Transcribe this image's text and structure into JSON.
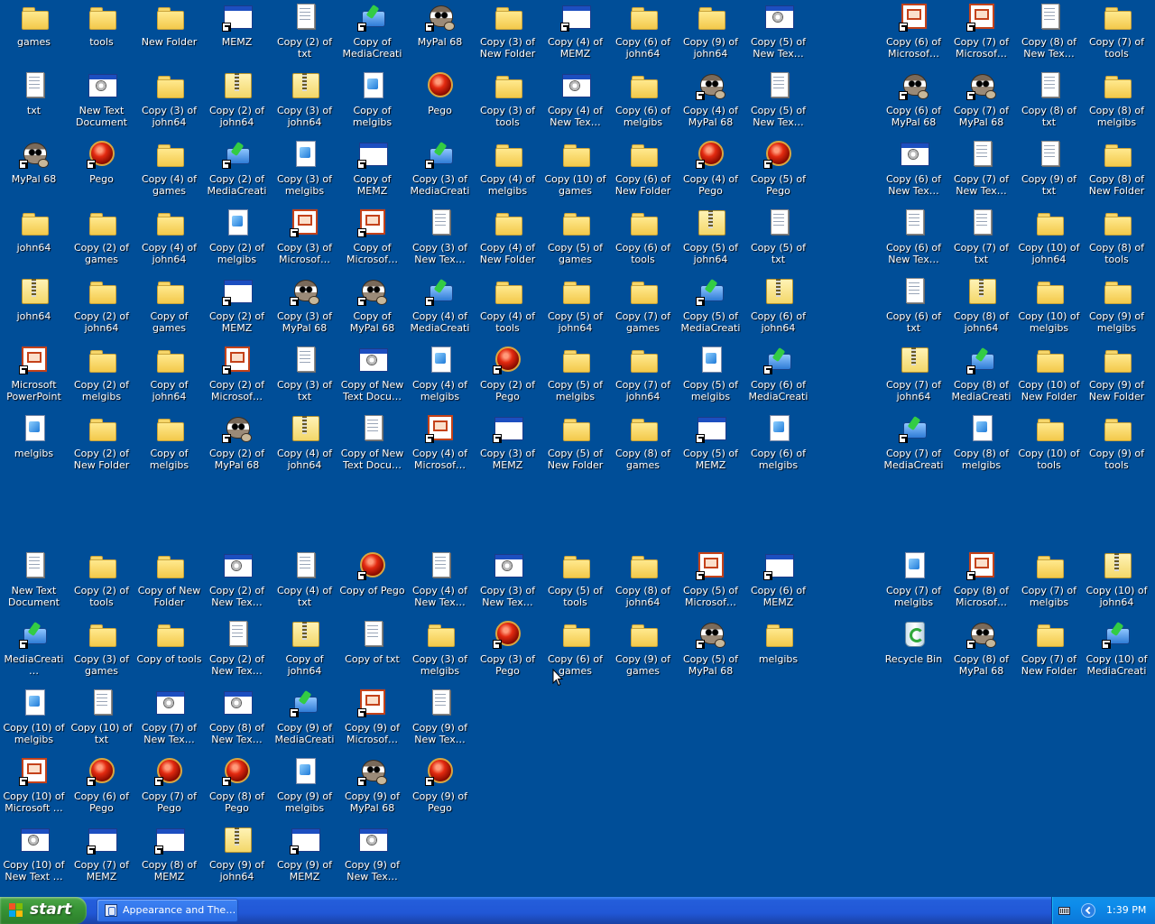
{
  "desktop": {
    "icons": [
      {
        "label": "games",
        "type": "folder",
        "shortcut": false
      },
      {
        "label": "tools",
        "type": "folder",
        "shortcut": false
      },
      {
        "label": "New Folder",
        "type": "folder",
        "shortcut": false
      },
      {
        "label": "MEMZ",
        "type": "app",
        "shortcut": true
      },
      {
        "label": "Copy (2) of txt",
        "type": "txt",
        "shortcut": false
      },
      {
        "label": "Copy of MediaCreati…",
        "type": "media",
        "shortcut": true
      },
      {
        "label": "MyPal 68",
        "type": "raccoon",
        "shortcut": true
      },
      {
        "label": "Copy (3) of New Folder",
        "type": "folder",
        "shortcut": false
      },
      {
        "label": "Copy (4) of MEMZ",
        "type": "app",
        "shortcut": true
      },
      {
        "label": "Copy (6) of john64",
        "type": "folder",
        "shortcut": false
      },
      {
        "label": "Copy (9) of john64",
        "type": "folder",
        "shortcut": false
      },
      {
        "label": "Copy (5) of New Tex…",
        "type": "window",
        "shortcut": false
      },
      {
        "label": "Copy (6) of Microsof…",
        "type": "ppt",
        "shortcut": true
      },
      {
        "label": "Copy (7) of Microsof…",
        "type": "ppt",
        "shortcut": true
      },
      {
        "label": "Copy (8) of New Tex…",
        "type": "txt",
        "shortcut": false
      },
      {
        "label": "Copy (7) of tools",
        "type": "folder",
        "shortcut": false
      },
      {
        "label": "txt",
        "type": "txt",
        "shortcut": false
      },
      {
        "label": "New Text Document",
        "type": "window",
        "shortcut": false
      },
      {
        "label": "Copy (3) of john64",
        "type": "folder",
        "shortcut": false
      },
      {
        "label": "Copy (2) of john64",
        "type": "zip",
        "shortcut": false
      },
      {
        "label": "Copy (3) of john64",
        "type": "zip",
        "shortcut": false
      },
      {
        "label": "Copy of melgibs",
        "type": "doc",
        "shortcut": false
      },
      {
        "label": "Pego",
        "type": "red",
        "shortcut": false
      },
      {
        "label": "Copy (3) of tools",
        "type": "folder",
        "shortcut": false
      },
      {
        "label": "Copy (4) of New Tex…",
        "type": "window",
        "shortcut": false
      },
      {
        "label": "Copy (6) of melgibs",
        "type": "folder",
        "shortcut": false
      },
      {
        "label": "Copy (4) of MyPal 68",
        "type": "raccoon",
        "shortcut": true
      },
      {
        "label": "Copy (5) of New Tex…",
        "type": "txt",
        "shortcut": false
      },
      {
        "label": "Copy (6) of MyPal 68",
        "type": "raccoon",
        "shortcut": true
      },
      {
        "label": "Copy (7) of MyPal 68",
        "type": "raccoon",
        "shortcut": true
      },
      {
        "label": "Copy (8) of txt",
        "type": "txt",
        "shortcut": false
      },
      {
        "label": "Copy (8) of melgibs",
        "type": "folder",
        "shortcut": false
      },
      {
        "label": "MyPal 68",
        "type": "raccoon",
        "shortcut": true
      },
      {
        "label": "Pego",
        "type": "red",
        "shortcut": true
      },
      {
        "label": "Copy (4) of games",
        "type": "folder",
        "shortcut": false
      },
      {
        "label": "Copy (2) of MediaCreati…",
        "type": "media",
        "shortcut": true
      },
      {
        "label": "Copy (3) of melgibs",
        "type": "doc",
        "shortcut": false
      },
      {
        "label": "Copy of MEMZ",
        "type": "app",
        "shortcut": true
      },
      {
        "label": "Copy (3) of MediaCreati…",
        "type": "media",
        "shortcut": true
      },
      {
        "label": "Copy (4) of melgibs",
        "type": "folder",
        "shortcut": false
      },
      {
        "label": "Copy (10) of games",
        "type": "folder",
        "shortcut": false
      },
      {
        "label": "Copy (6) of New Folder",
        "type": "folder",
        "shortcut": false
      },
      {
        "label": "Copy (4) of Pego",
        "type": "red",
        "shortcut": true
      },
      {
        "label": "Copy (5) of Pego",
        "type": "red",
        "shortcut": true
      },
      {
        "label": "Copy (6) of New Tex…",
        "type": "window",
        "shortcut": false
      },
      {
        "label": "Copy (7) of New Tex…",
        "type": "txt",
        "shortcut": false
      },
      {
        "label": "Copy (9) of txt",
        "type": "txt",
        "shortcut": false
      },
      {
        "label": "Copy (8) of New Folder",
        "type": "folder",
        "shortcut": false
      },
      {
        "label": "john64",
        "type": "folder",
        "shortcut": false
      },
      {
        "label": "Copy (2) of games",
        "type": "folder",
        "shortcut": false
      },
      {
        "label": "Copy (4) of john64",
        "type": "folder",
        "shortcut": false
      },
      {
        "label": "Copy (2) of melgibs",
        "type": "doc",
        "shortcut": false
      },
      {
        "label": "Copy (3) of Microsof…",
        "type": "ppt",
        "shortcut": true
      },
      {
        "label": "Copy of Microsof…",
        "type": "ppt",
        "shortcut": true
      },
      {
        "label": "Copy (3) of New Tex…",
        "type": "txt",
        "shortcut": false
      },
      {
        "label": "Copy (4) of New Folder",
        "type": "folder",
        "shortcut": false
      },
      {
        "label": "Copy (5) of games",
        "type": "folder",
        "shortcut": false
      },
      {
        "label": "Copy (6) of tools",
        "type": "folder",
        "shortcut": false
      },
      {
        "label": "Copy (5) of john64",
        "type": "zip",
        "shortcut": false
      },
      {
        "label": "Copy (5) of txt",
        "type": "txt",
        "shortcut": false
      },
      {
        "label": "Copy (6) of New Tex…",
        "type": "txt",
        "shortcut": false
      },
      {
        "label": "Copy (7) of txt",
        "type": "txt",
        "shortcut": false
      },
      {
        "label": "Copy (10) of john64",
        "type": "folder",
        "shortcut": false
      },
      {
        "label": "Copy (8) of tools",
        "type": "folder",
        "shortcut": false
      },
      {
        "label": "john64",
        "type": "zip",
        "shortcut": false
      },
      {
        "label": "Copy (2) of john64",
        "type": "folder",
        "shortcut": false
      },
      {
        "label": "Copy of games",
        "type": "folder",
        "shortcut": false
      },
      {
        "label": "Copy (2) of MEMZ",
        "type": "app",
        "shortcut": true
      },
      {
        "label": "Copy (3) of MyPal 68",
        "type": "raccoon",
        "shortcut": true
      },
      {
        "label": "Copy of MyPal 68",
        "type": "raccoon",
        "shortcut": true
      },
      {
        "label": "Copy (4) of MediaCreati…",
        "type": "media",
        "shortcut": true
      },
      {
        "label": "Copy (4) of tools",
        "type": "folder",
        "shortcut": false
      },
      {
        "label": "Copy (5) of john64",
        "type": "folder",
        "shortcut": false
      },
      {
        "label": "Copy (7) of games",
        "type": "folder",
        "shortcut": false
      },
      {
        "label": "Copy (5) of MediaCreati…",
        "type": "media",
        "shortcut": true
      },
      {
        "label": "Copy (6) of john64",
        "type": "zip",
        "shortcut": false
      },
      {
        "label": "Copy (6) of txt",
        "type": "txt",
        "shortcut": false
      },
      {
        "label": "Copy (8) of john64",
        "type": "zip",
        "shortcut": false
      },
      {
        "label": "Copy (10) of melgibs",
        "type": "folder",
        "shortcut": false
      },
      {
        "label": "Copy (9) of melgibs",
        "type": "folder",
        "shortcut": false
      },
      {
        "label": "Microsoft PowerPoint",
        "type": "ppt",
        "shortcut": true
      },
      {
        "label": "Copy (2) of melgibs",
        "type": "folder",
        "shortcut": false
      },
      {
        "label": "Copy of john64",
        "type": "folder",
        "shortcut": false
      },
      {
        "label": "Copy (2) of Microsof…",
        "type": "ppt",
        "shortcut": true
      },
      {
        "label": "Copy (3) of txt",
        "type": "txt",
        "shortcut": false
      },
      {
        "label": "Copy of New Text Docu…",
        "type": "window",
        "shortcut": false
      },
      {
        "label": "Copy (4) of melgibs",
        "type": "doc",
        "shortcut": false
      },
      {
        "label": "Copy (2) of Pego",
        "type": "red",
        "shortcut": true
      },
      {
        "label": "Copy (5) of melgibs",
        "type": "folder",
        "shortcut": false
      },
      {
        "label": "Copy (7) of john64",
        "type": "folder",
        "shortcut": false
      },
      {
        "label": "Copy (5) of melgibs",
        "type": "doc",
        "shortcut": false
      },
      {
        "label": "Copy (6) of MediaCreati…",
        "type": "media",
        "shortcut": true
      },
      {
        "label": "Copy (7) of john64",
        "type": "zip",
        "shortcut": false
      },
      {
        "label": "Copy (8) of MediaCreati…",
        "type": "media",
        "shortcut": true
      },
      {
        "label": "Copy (10) of New Folder",
        "type": "folder",
        "shortcut": false
      },
      {
        "label": "Copy (9) of New Folder",
        "type": "folder",
        "shortcut": false
      },
      {
        "label": "melgibs",
        "type": "doc",
        "shortcut": false
      },
      {
        "label": "Copy (2) of New Folder",
        "type": "folder",
        "shortcut": false
      },
      {
        "label": "Copy of melgibs",
        "type": "folder",
        "shortcut": false
      },
      {
        "label": "Copy (2) of MyPal 68",
        "type": "raccoon",
        "shortcut": true
      },
      {
        "label": "Copy (4) of john64",
        "type": "zip",
        "shortcut": false
      },
      {
        "label": "Copy of New Text Docu…",
        "type": "txt",
        "shortcut": false
      },
      {
        "label": "Copy (4) of Microsof…",
        "type": "ppt",
        "shortcut": true
      },
      {
        "label": "Copy (3) of MEMZ",
        "type": "app",
        "shortcut": true
      },
      {
        "label": "Copy (5) of New Folder",
        "type": "folder",
        "shortcut": false
      },
      {
        "label": "Copy (8) of games",
        "type": "folder",
        "shortcut": false
      },
      {
        "label": "Copy (5) of MEMZ",
        "type": "app",
        "shortcut": true
      },
      {
        "label": "Copy (6) of melgibs",
        "type": "doc",
        "shortcut": false
      },
      {
        "label": "Copy (7) of MediaCreati…",
        "type": "media",
        "shortcut": true
      },
      {
        "label": "Copy (8) of melgibs",
        "type": "doc",
        "shortcut": false
      },
      {
        "label": "Copy (10) of tools",
        "type": "folder",
        "shortcut": false
      },
      {
        "label": "Copy (9) of tools",
        "type": "folder",
        "shortcut": false
      },
      {
        "label": "New Text Document",
        "type": "txt",
        "shortcut": false
      },
      {
        "label": "Copy (2) of tools",
        "type": "folder",
        "shortcut": false
      },
      {
        "label": "Copy of New Folder",
        "type": "folder",
        "shortcut": false
      },
      {
        "label": "Copy (2) of New Tex…",
        "type": "window",
        "shortcut": false
      },
      {
        "label": "Copy (4) of txt",
        "type": "txt",
        "shortcut": false
      },
      {
        "label": "Copy of Pego",
        "type": "red",
        "shortcut": true
      },
      {
        "label": "Copy (4) of New Tex…",
        "type": "txt",
        "shortcut": false
      },
      {
        "label": "Copy (3) of New Tex…",
        "type": "window",
        "shortcut": false
      },
      {
        "label": "Copy (5) of tools",
        "type": "folder",
        "shortcut": false
      },
      {
        "label": "Copy (8) of john64",
        "type": "folder",
        "shortcut": false
      },
      {
        "label": "Copy (5) of Microsof…",
        "type": "ppt",
        "shortcut": true
      },
      {
        "label": "Copy (6) of MEMZ",
        "type": "app",
        "shortcut": true
      },
      {
        "label": "Copy (7) of melgibs",
        "type": "doc",
        "shortcut": false
      },
      {
        "label": "Copy (8) of Microsof…",
        "type": "ppt",
        "shortcut": true
      },
      {
        "label": "Copy (7) of melgibs",
        "type": "folder",
        "shortcut": false
      },
      {
        "label": "Copy (10) of john64",
        "type": "zip",
        "shortcut": false
      },
      {
        "label": "MediaCreati…",
        "type": "media",
        "shortcut": true
      },
      {
        "label": "Copy (3) of games",
        "type": "folder",
        "shortcut": false
      },
      {
        "label": "Copy of tools",
        "type": "folder",
        "shortcut": false
      },
      {
        "label": "Copy (2) of New Tex…",
        "type": "txt",
        "shortcut": false
      },
      {
        "label": "Copy of john64",
        "type": "zip",
        "shortcut": false
      },
      {
        "label": "Copy of txt",
        "type": "txt",
        "shortcut": false
      },
      {
        "label": "Copy (3) of melgibs",
        "type": "folder",
        "shortcut": false
      },
      {
        "label": "Copy (3) of Pego",
        "type": "red",
        "shortcut": true
      },
      {
        "label": "Copy (6) of games",
        "type": "folder",
        "shortcut": false
      },
      {
        "label": "Copy (9) of games",
        "type": "folder",
        "shortcut": false
      },
      {
        "label": "Copy (5) of MyPal 68",
        "type": "raccoon",
        "shortcut": true
      },
      {
        "label": "melgibs",
        "type": "folder",
        "shortcut": false
      },
      {
        "label": "Recycle Bin",
        "type": "recycle",
        "shortcut": false
      },
      {
        "label": "Copy (8) of MyPal 68",
        "type": "raccoon",
        "shortcut": true
      },
      {
        "label": "Copy (7) of New Folder",
        "type": "folder",
        "shortcut": false
      },
      {
        "label": "Copy (10) of MediaCreati…",
        "type": "media",
        "shortcut": true
      },
      {
        "label": "Copy (10) of melgibs",
        "type": "doc",
        "shortcut": false
      },
      {
        "label": "Copy (10) of txt",
        "type": "txt",
        "shortcut": false
      },
      {
        "label": "Copy (7) of New Tex…",
        "type": "window",
        "shortcut": false
      },
      {
        "label": "Copy (8) of New Tex…",
        "type": "window",
        "shortcut": false
      },
      {
        "label": "Copy (9) of MediaCreati…",
        "type": "media",
        "shortcut": true
      },
      {
        "label": "Copy (9) of Microsof…",
        "type": "ppt",
        "shortcut": true
      },
      {
        "label": "Copy (9) of New Tex…",
        "type": "txt",
        "shortcut": false
      },
      {
        "label": "Copy (10) of Microsoft …",
        "type": "ppt",
        "shortcut": true
      },
      {
        "label": "Copy (6) of Pego",
        "type": "red",
        "shortcut": true
      },
      {
        "label": "Copy (7) of Pego",
        "type": "red",
        "shortcut": true
      },
      {
        "label": "Copy (8) of Pego",
        "type": "red",
        "shortcut": true
      },
      {
        "label": "Copy (9) of melgibs",
        "type": "doc",
        "shortcut": false
      },
      {
        "label": "Copy (9) of MyPal 68",
        "type": "raccoon",
        "shortcut": true
      },
      {
        "label": "Copy (9) of Pego",
        "type": "red",
        "shortcut": true
      },
      {
        "label": "Copy (10) of New Text …",
        "type": "window",
        "shortcut": false
      },
      {
        "label": "Copy (7) of MEMZ",
        "type": "app",
        "shortcut": true
      },
      {
        "label": "Copy (8) of MEMZ",
        "type": "app",
        "shortcut": true
      },
      {
        "label": "Copy (9) of john64",
        "type": "zip",
        "shortcut": false
      },
      {
        "label": "Copy (9) of MEMZ",
        "type": "app",
        "shortcut": true
      },
      {
        "label": "Copy (9) of New Tex…",
        "type": "window",
        "shortcut": false
      }
    ]
  },
  "taskbar": {
    "start_label": "start",
    "tasks": [
      {
        "label": "Appearance and The…"
      }
    ],
    "clock": "1:39 PM"
  },
  "colors": {
    "desktop_background": "#004e98",
    "taskbar": "#245edb",
    "start_button": "#389636",
    "tray": "#0b77d8"
  }
}
